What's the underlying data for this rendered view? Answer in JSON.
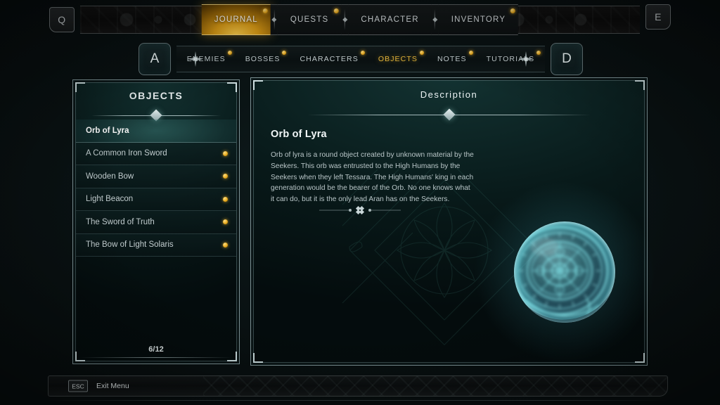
{
  "hud": {
    "left_key": "Q",
    "right_key": "E"
  },
  "top_tabs": [
    {
      "label": "JOURNAL",
      "active": true,
      "badge": true
    },
    {
      "label": "QUESTS",
      "active": false,
      "badge": true
    },
    {
      "label": "CHARACTER",
      "active": false,
      "badge": false
    },
    {
      "label": "INVENTORY",
      "active": false,
      "badge": true
    }
  ],
  "subnav": {
    "prev_key": "A",
    "next_key": "D",
    "left_icon": "compass-star-icon",
    "right_icon": "compass-star-icon",
    "items": [
      {
        "label": "ENEMIES",
        "active": false,
        "badge": true
      },
      {
        "label": "BOSSES",
        "active": false,
        "badge": true
      },
      {
        "label": "CHARACTERS",
        "active": false,
        "badge": true
      },
      {
        "label": "OBJECTS",
        "active": true,
        "badge": true
      },
      {
        "label": "NOTES",
        "active": false,
        "badge": true
      },
      {
        "label": "TUTORIALS",
        "active": false,
        "badge": true
      }
    ]
  },
  "list_panel": {
    "title": "OBJECTS",
    "count": "6/12",
    "items": [
      {
        "label": "Orb of Lyra",
        "selected": true,
        "badge": false
      },
      {
        "label": "A Common Iron Sword",
        "selected": false,
        "badge": true
      },
      {
        "label": "Wooden Bow",
        "selected": false,
        "badge": true
      },
      {
        "label": "Light Beacon",
        "selected": false,
        "badge": true
      },
      {
        "label": "The Sword of Truth",
        "selected": false,
        "badge": true
      },
      {
        "label": "The Bow of Light Solaris",
        "selected": false,
        "badge": true
      }
    ]
  },
  "description_panel": {
    "title": "Description",
    "item_name": "Orb of Lyra",
    "body": "Orb of lyra is a round object created by unknown material by the Seekers. This orb was entrusted to the High Humans by the Seekers when they left Tessara. The High Humans' king in each generation would be the bearer of the Orb. No one knows what it can do, but it is the only lead Aran has on the Seekers.",
    "artwork": "orb-of-lyra-rune-sphere"
  },
  "footer": {
    "key": "ESC",
    "label": "Exit Menu",
    "ornament": "diamond-knot-ornament"
  },
  "colors": {
    "accent_gold": "#e8b83c",
    "accent_teal": "#7fe3e8",
    "panel_border": "#7d9295",
    "background": "#0a1314",
    "text_primary": "#edf4f5",
    "text_secondary": "#b9c6c8"
  }
}
